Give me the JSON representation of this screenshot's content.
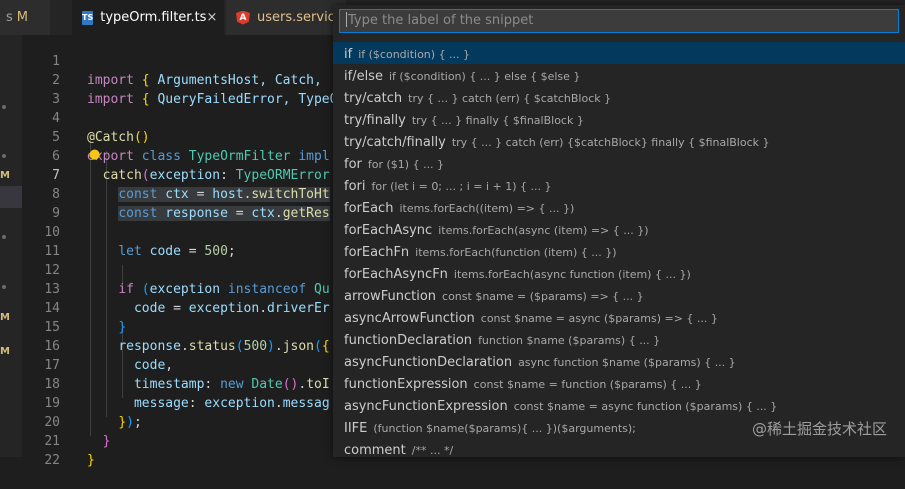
{
  "tabs": {
    "prev_fragment": "s",
    "prev_badge": "M",
    "active": {
      "icon": "TS",
      "label": "typeOrm.filter.ts",
      "close": "×"
    },
    "next": {
      "icon": "A",
      "label": "users.service"
    }
  },
  "sidebar_markers": [
    "M",
    "M",
    "M"
  ],
  "editor": {
    "line_numbers": [
      "1",
      "2",
      "3",
      "4",
      "5",
      "6",
      "7",
      "8",
      "9",
      "10",
      "11",
      "12",
      "13",
      "14",
      "15",
      "16",
      "17",
      "18",
      "19",
      "20",
      "21",
      "22"
    ],
    "current_line": "7",
    "lightbulb_icon": "lightbulb-icon",
    "l1": [
      "import",
      "{",
      " ArgumentsHost, Catch,"
    ],
    "l2": [
      "import",
      "{",
      " QueryFailedError, TypeO"
    ],
    "l4": [
      "@",
      "Catch",
      "(",
      ")"
    ],
    "l5": [
      "export",
      "class",
      "TypeOrmFilter",
      "impl"
    ],
    "l6": [
      "catch",
      "(",
      "exception",
      ": ",
      "TypeORMError"
    ],
    "l7": [
      "const",
      "ctx",
      " = ",
      "host",
      ".",
      "switchToHt"
    ],
    "l8": [
      "const",
      "response",
      " = ",
      "ctx",
      ".",
      "getRes"
    ],
    "l10": [
      "let",
      "code",
      " = ",
      "500",
      ";"
    ],
    "l12": [
      "if",
      "(",
      "exception",
      "instanceof",
      "Qu"
    ],
    "l13": [
      "code",
      " = ",
      "exception",
      ".",
      "driverEr"
    ],
    "l14": [
      "}"
    ],
    "l15": [
      "response",
      ".",
      "status",
      "(",
      "500",
      ")",
      ".",
      "json",
      "(",
      "{"
    ],
    "l16": [
      "code",
      ","
    ],
    "l17": [
      "timestamp",
      ": ",
      "new",
      "Date",
      "()",
      ".",
      "toI"
    ],
    "l18": [
      "message",
      ": ",
      "exception",
      ".",
      "messag"
    ],
    "l19": [
      "}",
      ")",
      ";"
    ],
    "l20": [
      "}"
    ],
    "l21": [
      "}"
    ]
  },
  "palette": {
    "placeholder": "Type the label of the snippet",
    "items": [
      {
        "label": "if",
        "desc": "if ($condition) { ... }"
      },
      {
        "label": "if/else",
        "desc": "if ($condition) { ... } else { $else }"
      },
      {
        "label": "try/catch",
        "desc": "try { ... } catch (err) { $catchBlock }"
      },
      {
        "label": "try/finally",
        "desc": "try { ... } finally { $finalBlock }"
      },
      {
        "label": "try/catch/finally",
        "desc": "try { ... } catch (err) {$catchBlock} finally { $finalBlock }"
      },
      {
        "label": "for",
        "desc": "for ($1) { ... }"
      },
      {
        "label": "fori",
        "desc": "for (let i = 0; ... ; i = i + 1) { ... }"
      },
      {
        "label": "forEach",
        "desc": "items.forEach((item) => { ... })"
      },
      {
        "label": "forEachAsync",
        "desc": "items.forEach(async (item) => { ... })"
      },
      {
        "label": "forEachFn",
        "desc": "items.forEach(function (item) { ... })"
      },
      {
        "label": "forEachAsyncFn",
        "desc": "items.forEach(async function (item) { ... })"
      },
      {
        "label": "arrowFunction",
        "desc": "const $name = ($params) => { ... }"
      },
      {
        "label": "asyncArrowFunction",
        "desc": "const $name = async ($params) => { ... }"
      },
      {
        "label": "functionDeclaration",
        "desc": "function $name ($params) { ... }"
      },
      {
        "label": "asyncFunctionDeclaration",
        "desc": "async function $name ($params) { ... }"
      },
      {
        "label": "functionExpression",
        "desc": "const $name = function ($params) { ... }"
      },
      {
        "label": "asyncFunctionExpression",
        "desc": "const $name = async function ($params) { ... }"
      },
      {
        "label": "IIFE",
        "desc": "(function $name($params){ ... })($arguments);"
      },
      {
        "label": "comment",
        "desc": "/** ... */"
      }
    ]
  },
  "watermark": "@稀土掘金技术社区",
  "colors": {
    "accent": "#007fd4",
    "selection": "#04395e",
    "background": "#1e1e1e"
  }
}
